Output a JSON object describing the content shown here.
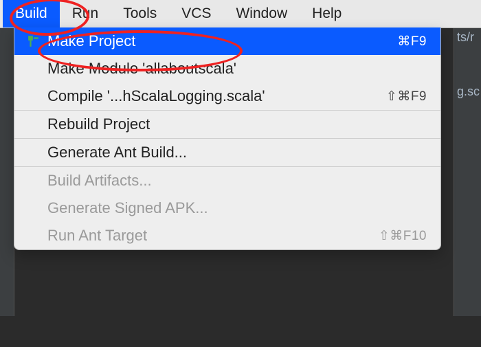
{
  "menubar": {
    "items": [
      {
        "label": "Build",
        "active": true
      },
      {
        "label": "Run",
        "active": false
      },
      {
        "label": "Tools",
        "active": false
      },
      {
        "label": "VCS",
        "active": false
      },
      {
        "label": "Window",
        "active": false
      },
      {
        "label": "Help",
        "active": false
      }
    ]
  },
  "dropdown": {
    "items": [
      {
        "label": "Make Project",
        "shortcut": "⌘F9",
        "highlight": true,
        "icon": "build-hammer-icon",
        "enabled": true
      },
      {
        "label": "Make Module 'allaboutscala'",
        "shortcut": "",
        "highlight": false,
        "icon": "",
        "enabled": true
      },
      {
        "label": "Compile '...hScalaLogging.scala'",
        "shortcut": "⇧⌘F9",
        "highlight": false,
        "icon": "",
        "enabled": true
      },
      {
        "sep": true
      },
      {
        "label": "Rebuild Project",
        "shortcut": "",
        "highlight": false,
        "icon": "",
        "enabled": true
      },
      {
        "sep": true
      },
      {
        "label": "Generate Ant Build...",
        "shortcut": "",
        "highlight": false,
        "icon": "",
        "enabled": true
      },
      {
        "sep": true
      },
      {
        "label": "Build Artifacts...",
        "shortcut": "",
        "highlight": false,
        "icon": "",
        "enabled": false
      },
      {
        "label": "Generate Signed APK...",
        "shortcut": "",
        "highlight": false,
        "icon": "",
        "enabled": false
      },
      {
        "label": "Run Ant Target",
        "shortcut": "⇧⌘F10",
        "highlight": false,
        "icon": "",
        "enabled": false
      }
    ]
  },
  "bg": {
    "r1": "ts/r",
    "r2": "g.sc"
  }
}
